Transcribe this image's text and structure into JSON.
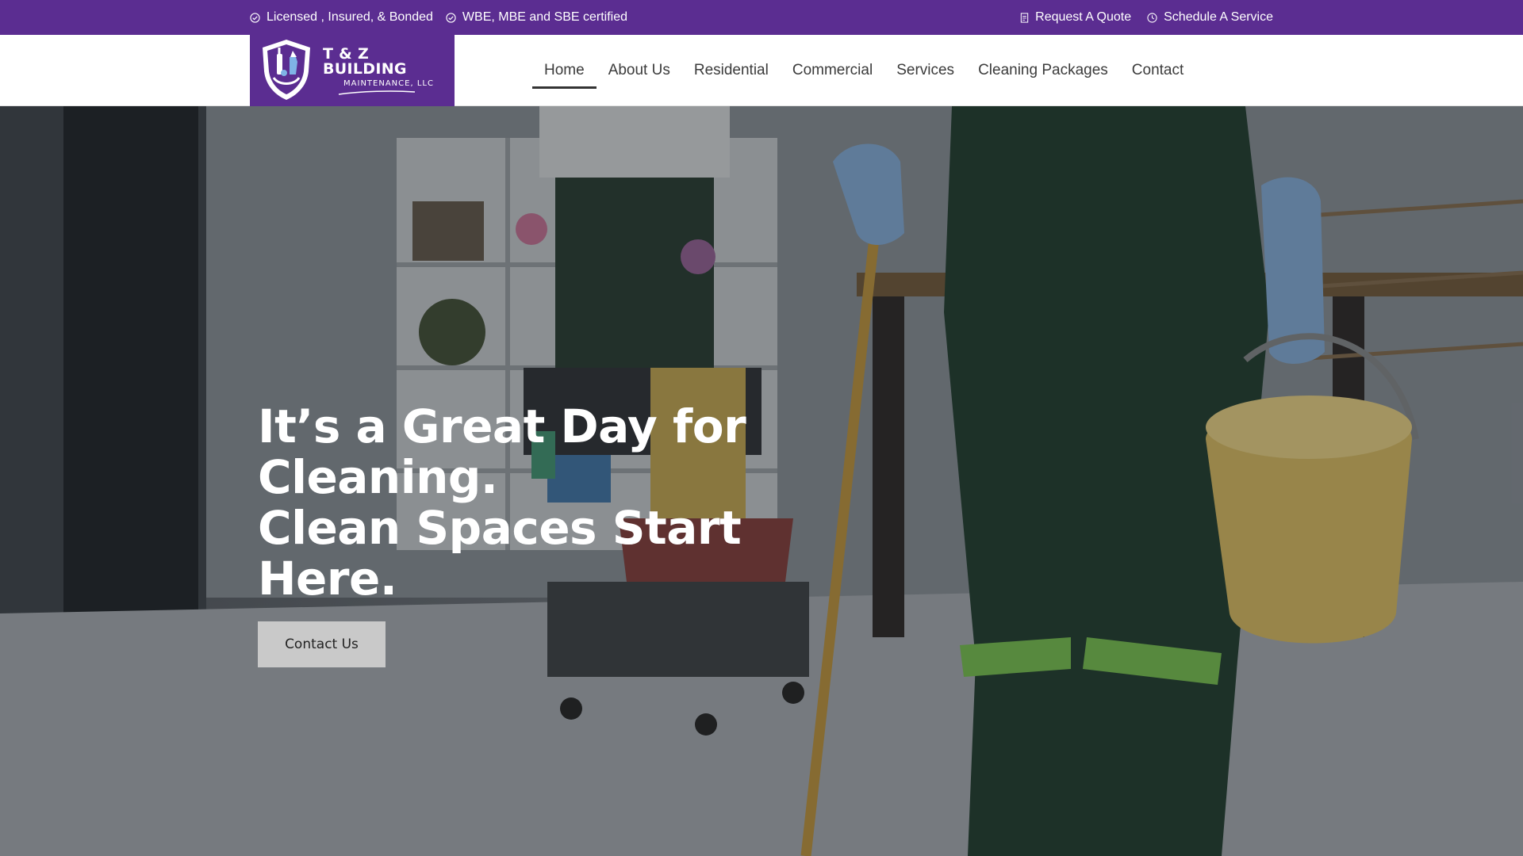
{
  "topbar": {
    "badges": [
      {
        "icon": "check-circle-icon",
        "label": "Licensed , Insured, & Bonded"
      },
      {
        "icon": "check-circle-icon",
        "label": "WBE, MBE and SBE certified"
      }
    ],
    "links": [
      {
        "icon": "document-icon",
        "label": "Request A Quote"
      },
      {
        "icon": "clock-icon",
        "label": "Schedule A Service"
      }
    ]
  },
  "logo": {
    "line1": "T & Z BUILDING",
    "line2": "MAINTENANCE, LLC"
  },
  "nav": {
    "items": [
      {
        "label": "Home",
        "active": true
      },
      {
        "label": "About Us"
      },
      {
        "label": "Residential"
      },
      {
        "label": "Commercial"
      },
      {
        "label": "Services"
      },
      {
        "label": "Cleaning Packages"
      },
      {
        "label": "Contact"
      }
    ]
  },
  "hero": {
    "headline_lines": [
      "It’s a Great Day for",
      "Cleaning.",
      "Clean Spaces Start",
      "Here."
    ],
    "cta_label": "Contact Us"
  },
  "colors": {
    "brand_purple": "#5b2d91",
    "cta_bg": "#c9c9c9"
  }
}
